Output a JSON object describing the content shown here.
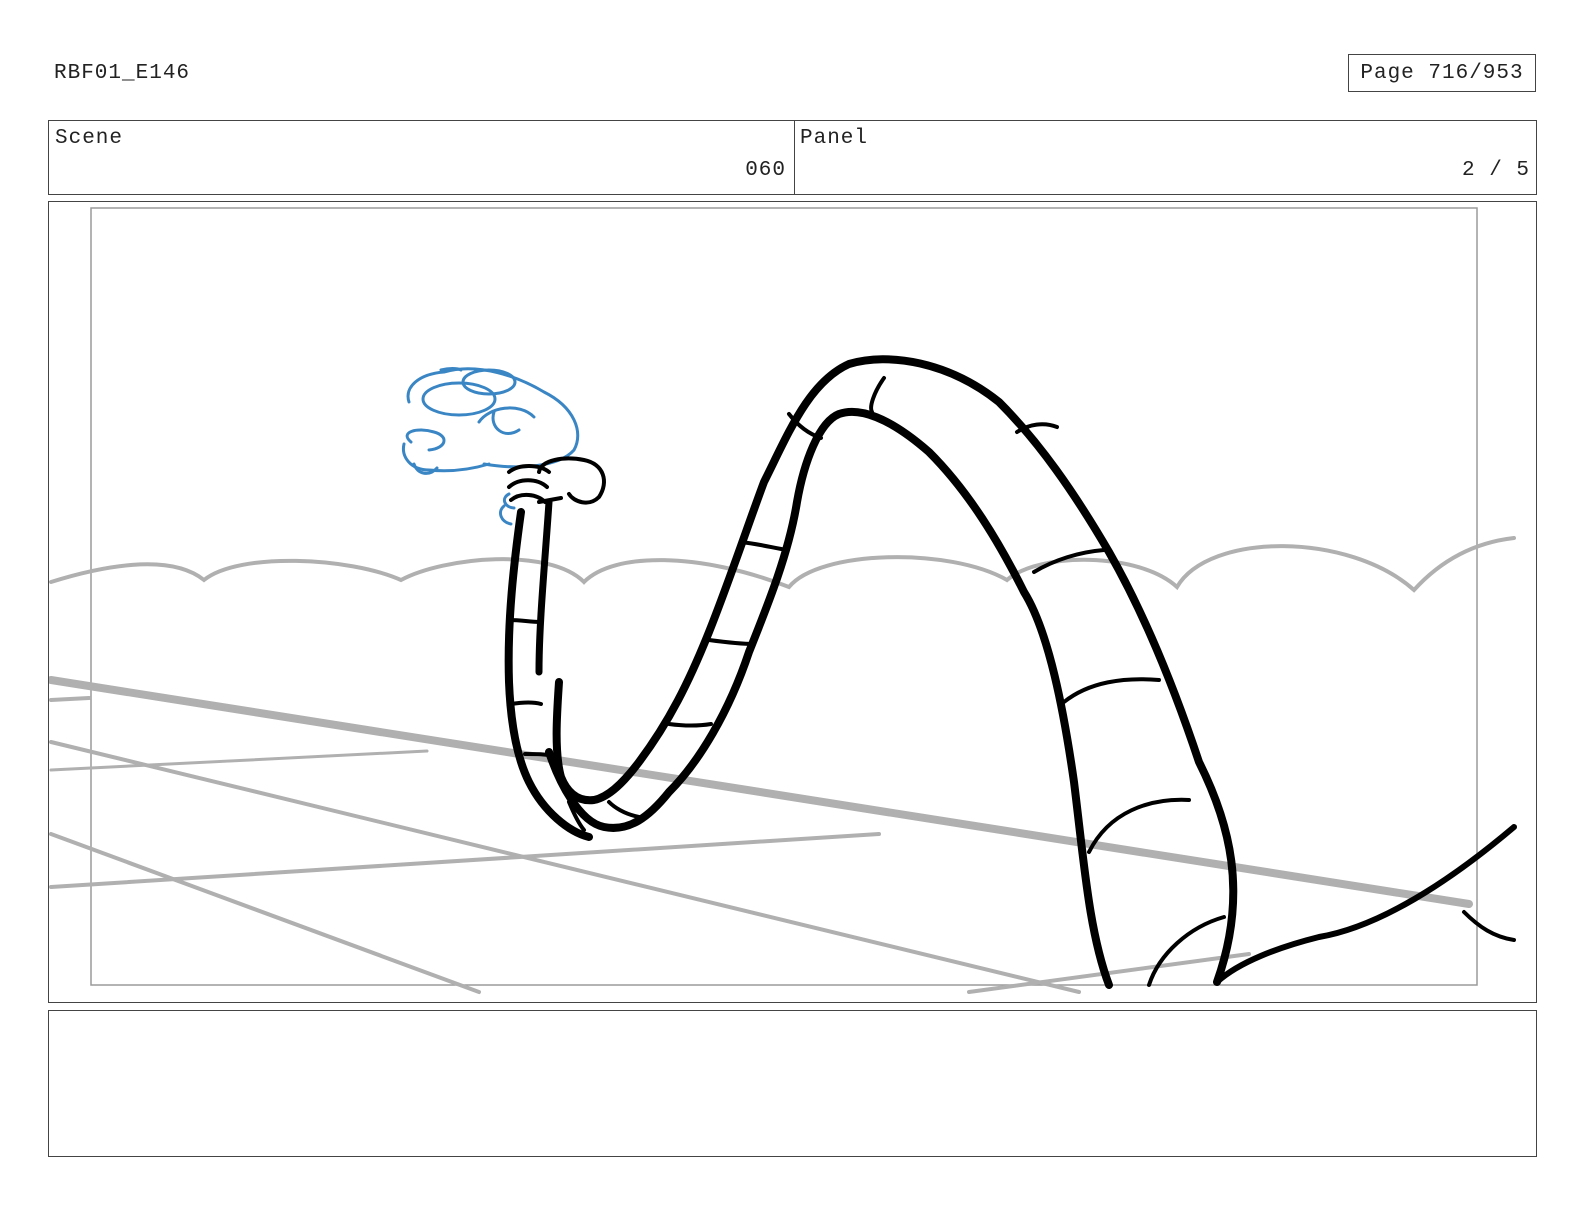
{
  "header": {
    "doc_id": "RBF01_E146",
    "page": "Page 716/953"
  },
  "info": {
    "scene_label": "Scene",
    "scene_value": "060",
    "panel_label": "Panel",
    "panel_value": "2 / 5"
  },
  "drawing": {
    "line_color": "#000000",
    "background_line_color": "#b0b0b0",
    "character_sketch_color": "#3a86c4",
    "safe_area_color": "#9a9a9a"
  },
  "notes": {
    "text": ""
  }
}
